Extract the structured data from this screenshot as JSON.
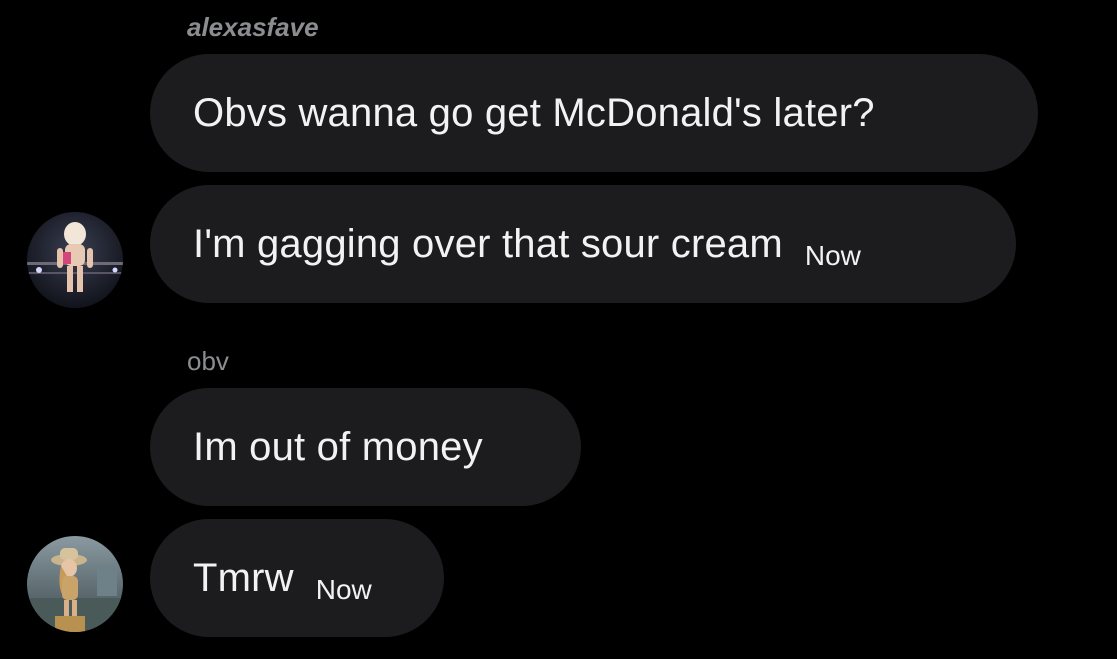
{
  "groups": [
    {
      "sender": "alexasfave",
      "messages": [
        {
          "text": "Obvs wanna go get McDonald's later?",
          "time": ""
        },
        {
          "text": "I'm gagging over that sour cream",
          "time": "Now"
        }
      ],
      "avatar_icon": "profile-photo-wrestler-ring"
    },
    {
      "sender": "obv",
      "messages": [
        {
          "text": "Im out of money",
          "time": ""
        },
        {
          "text": "Tmrw",
          "time": "Now"
        }
      ],
      "avatar_icon": "profile-photo-cowboy-hat"
    }
  ],
  "colors": {
    "background": "#000000",
    "bubble": "#1c1c1e",
    "text": "#f2f2f2",
    "sender": "#8b8d90"
  }
}
